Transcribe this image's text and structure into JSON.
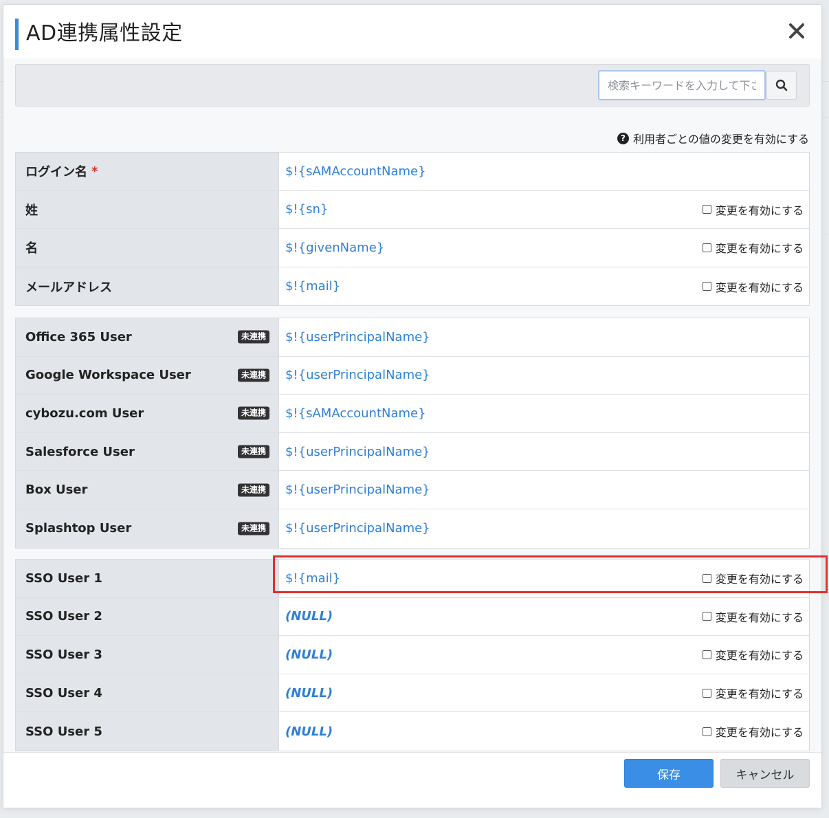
{
  "dialog": {
    "title": "AD連携属性設定",
    "search_placeholder": "検索キーワードを入力して下さい",
    "per_user_note": "利用者ごとの値の変更を有効にする"
  },
  "groups": [
    {
      "rows": [
        {
          "label": "ログイン名",
          "required": "*",
          "value": "$!{sAMAccountName}",
          "checkbox": ""
        },
        {
          "label": "姓",
          "value": "$!{sn}",
          "checkbox": "変更を有効にする"
        },
        {
          "label": "名",
          "value": "$!{givenName}",
          "checkbox": "変更を有効にする"
        },
        {
          "label": "メールアドレス",
          "value": "$!{mail}",
          "checkbox": "変更を有効にする"
        }
      ]
    },
    {
      "rows": [
        {
          "label": "Office 365 User",
          "badge": "未連携",
          "value": "$!{userPrincipalName}"
        },
        {
          "label": "Google Workspace User",
          "badge": "未連携",
          "value": "$!{userPrincipalName}"
        },
        {
          "label": "cybozu.com User",
          "badge": "未連携",
          "value": "$!{sAMAccountName}"
        },
        {
          "label": "Salesforce User",
          "badge": "未連携",
          "value": "$!{userPrincipalName}"
        },
        {
          "label": "Box User",
          "badge": "未連携",
          "value": "$!{userPrincipalName}"
        },
        {
          "label": "Splashtop User",
          "badge": "未連携",
          "value": "$!{userPrincipalName}"
        }
      ]
    },
    {
      "rows": [
        {
          "label": "SSO User 1",
          "value": "$!{mail}",
          "checkbox": "変更を有効にする"
        },
        {
          "label": "SSO User 2",
          "value": "(NULL)",
          "checkbox": "変更を有効にする"
        },
        {
          "label": "SSO User 3",
          "value": "(NULL)",
          "checkbox": "変更を有効にする"
        },
        {
          "label": "SSO User 4",
          "value": "(NULL)",
          "checkbox": "変更を有効にする"
        },
        {
          "label": "SSO User 5",
          "value": "(NULL)",
          "checkbox": "変更を有効にする"
        }
      ]
    }
  ],
  "footer": {
    "save_label": "保存",
    "cancel_label": "キャンセル"
  },
  "colors": {
    "accent": "#3a8ad8",
    "value_link": "#2e7fd6",
    "highlight": "#e0312a",
    "label_bg": "#e2e5e9"
  }
}
